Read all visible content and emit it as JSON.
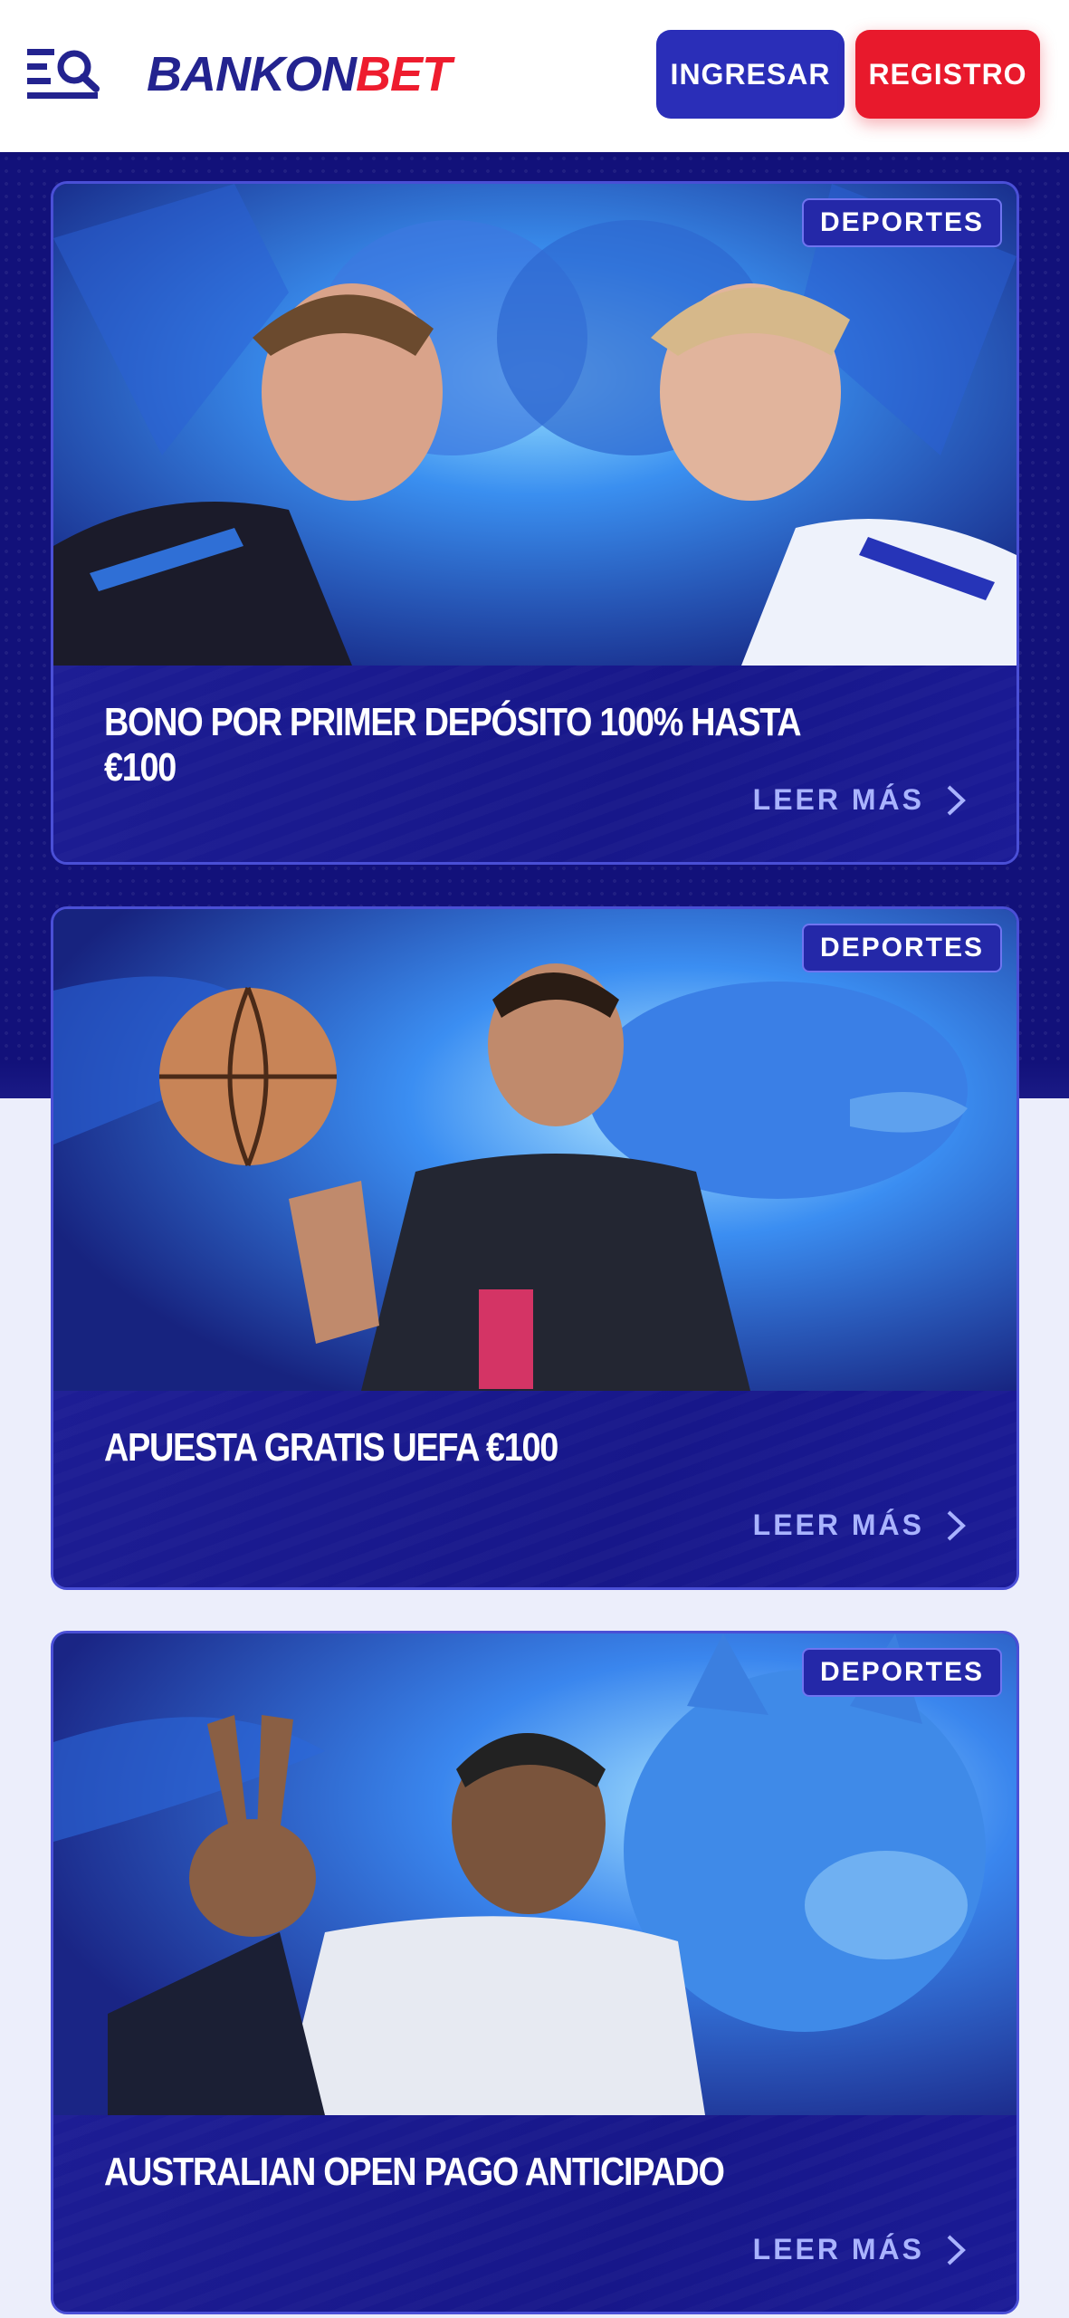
{
  "header": {
    "logo_part1": "BANKON",
    "logo_part2": "BET",
    "login_label": "INGRESAR",
    "register_label": "REGISTRO"
  },
  "promotions": [
    {
      "badge": "DEPORTES",
      "title": "BONO POR PRIMER DEPÓSITO 100% HASTA €100",
      "read_more": "LEER MÁS",
      "image": "football-players-lion-gorilla"
    },
    {
      "badge": "DEPORTES",
      "title": "APUESTA GRATIS UEFA €100",
      "read_more": "LEER MÁS",
      "image": "basketball-player-dolphin"
    },
    {
      "badge": "DEPORTES",
      "title": "AUSTRALIAN OPEN PAGO ANTICIPADO",
      "read_more": "LEER MÁS",
      "image": "tennis-player-wolf"
    }
  ],
  "colors": {
    "brand_blue": "#23238f",
    "brand_red": "#ee1c2e",
    "login_button": "#2a2eb8",
    "register_button": "#e8192c",
    "hero_background": "#12117a",
    "card_body": "#1b1b8e",
    "read_more_text": "#a9b3ff"
  }
}
